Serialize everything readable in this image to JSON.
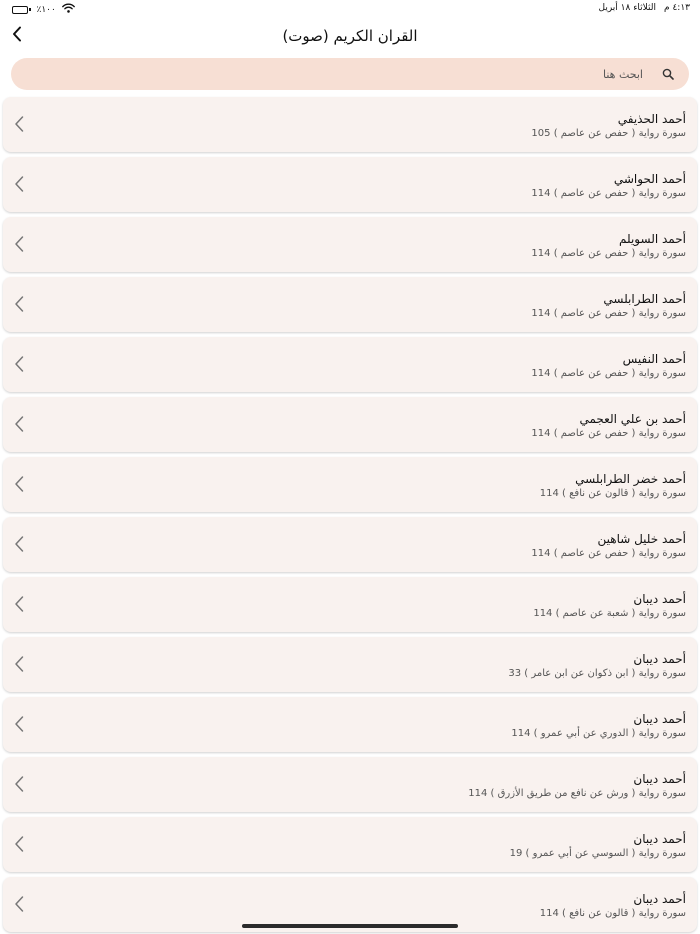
{
  "status_bar": {
    "time": "٤:١٣ م",
    "date": "الثلاثاء ١٨ أبريل",
    "battery_text": "٪١٠٠",
    "battery_level": 1.0
  },
  "header": {
    "title": "القران الكريم (صوت)"
  },
  "search": {
    "placeholder": "ابحث هنا",
    "value": ""
  },
  "reciters": [
    {
      "name": "أحمد الحذيفي",
      "info": "سورة رواية  ( حفص عن عاصم ) 105"
    },
    {
      "name": "أحمد الحواشي",
      "info": "سورة رواية  ( حفص عن عاصم ) 114"
    },
    {
      "name": "أحمد السويلم",
      "info": "سورة رواية  ( حفص عن عاصم ) 114"
    },
    {
      "name": "أحمد الطرابلسي",
      "info": "سورة رواية  ( حفص عن عاصم ) 114"
    },
    {
      "name": "أحمد النفيس",
      "info": "سورة رواية  ( حفص عن عاصم ) 114"
    },
    {
      "name": "أحمد بن علي العجمي",
      "info": "سورة رواية  ( حفص عن عاصم ) 114"
    },
    {
      "name": "أحمد خضر الطرابلسي",
      "info": "سورة رواية  ( قالون عن نافع ) 114"
    },
    {
      "name": "أحمد خليل شاهين",
      "info": "سورة رواية  ( حفص عن عاصم ) 114"
    },
    {
      "name": "أحمد ديبان",
      "info": "سورة رواية  ( شعبة  عن عاصم ) 114"
    },
    {
      "name": "أحمد ديبان",
      "info": "سورة رواية  ( ابن ذكوان عن ابن عامر ) 33"
    },
    {
      "name": "أحمد ديبان",
      "info": "سورة رواية  ( الدوري عن أبي عمرو ) 114"
    },
    {
      "name": "أحمد ديبان",
      "info": "سورة رواية  ( ورش عن نافع من طريق الأزرق ) 114"
    },
    {
      "name": "أحمد ديبان",
      "info": "سورة رواية  ( السوسي عن أبي عمرو ) 19"
    },
    {
      "name": "أحمد ديبان",
      "info": "سورة رواية  ( قالون عن نافع ) 114"
    }
  ],
  "icons": {
    "back": "chevron-left-icon",
    "search": "magnifier-icon",
    "row": "chevron-left-icon",
    "wifi": "wifi-icon",
    "battery": "battery-icon"
  },
  "colors": {
    "search_bg": "#f7dfd4",
    "row_bg": "#f9f2ef",
    "text": "#111111",
    "subtext": "#555555"
  }
}
